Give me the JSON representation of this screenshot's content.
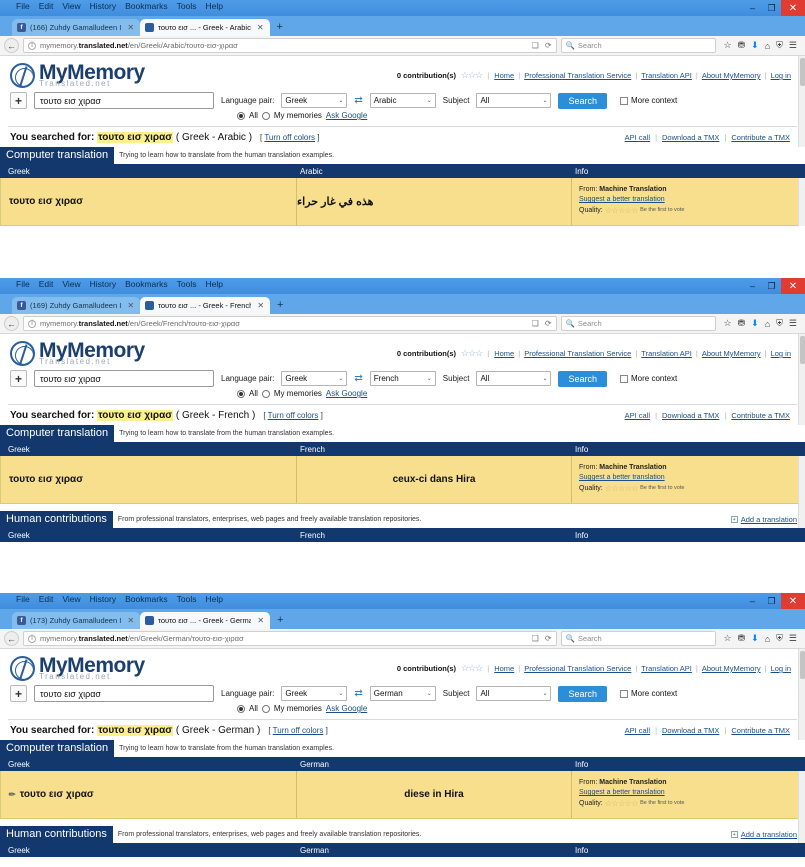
{
  "browser": {
    "menu_items": [
      "File",
      "Edit",
      "View",
      "History",
      "Bookmarks",
      "Tools",
      "Help"
    ],
    "window_controls": {
      "minimize": "–",
      "restore": "❐",
      "close": "✕"
    },
    "new_tab_label": "+",
    "tab_close_label": "✕",
    "nav": {
      "back_label": "←",
      "reader_label": "❑",
      "reload_label": "⟳",
      "search_placeholder": "Search",
      "search_icon": "🔍",
      "info_icon": "i"
    },
    "toolbar_icons": [
      "☆",
      "⛃",
      "⬇",
      "⌂",
      "⛨",
      "☰"
    ]
  },
  "site": {
    "logo_main": "MyMemory",
    "logo_sub": "Translated.net",
    "contributions": "0 contribution(s)",
    "contribution_stars": "☆☆☆",
    "links": [
      "Home",
      "Professional Translation Service",
      "Translation API",
      "About MyMemory",
      "Log in"
    ],
    "separator": "|"
  },
  "search_form": {
    "add_button": "+",
    "query": "τουτο εισ χιρασ",
    "language_pair_label": "Language pair:",
    "subject_label": "Subject",
    "subject_value": "All",
    "swap_icon": "⇄",
    "search_button": "Search",
    "more_context_label": "More context",
    "radio_all": "All",
    "radio_my_memories": "My memories",
    "ask_google": "Ask Google",
    "caret": "⌄"
  },
  "results_common": {
    "searched_prefix": "You searched for:",
    "turn_off_colors": "Turn off colors",
    "turn_off_open": "[",
    "turn_off_close": "]",
    "tmx_links": [
      "API call",
      "Download a TMX",
      "Contribute a TMX"
    ],
    "computer_translation_title": "Computer translation",
    "computer_translation_sub": "Trying to learn how to translate from the human translation examples.",
    "human_contributions_title": "Human contributions",
    "human_contributions_sub": "From professional translators, enterprises, web pages and freely available translation repositories.",
    "add_translation": "Add a translation",
    "col_info": "Info",
    "from_label": "From:",
    "from_value": "Machine Translation",
    "suggest_better": "Suggest a better translation",
    "quality_label": "Quality:",
    "quality_stars": "☆☆☆☆☆",
    "be_first_to_vote": "Be the first to vote",
    "source_text": "τουτο εισ χιρασ",
    "source_lang": "Greek"
  },
  "windows": [
    {
      "tab_fb": "(166) Zuhdy Gamalludeen I",
      "tab_page": "τουτο εισ ... - Greek - Arabic",
      "url_host_pre": "mymemory.",
      "url_host_bold": "translated.net",
      "url_path": "/en/Greek/Arabic/τουτο-εισ-χιρασ",
      "lang_from": "Greek",
      "lang_to": "Arabic",
      "pair_label": "( Greek - Arabic )",
      "translation": "هذه في غار حراء",
      "rtl": true,
      "has_human_section": false,
      "has_pencil": false
    },
    {
      "tab_fb": "(169) Zuhdy Gamalludeen I",
      "tab_page": "τουτο εισ ... - Greek - French",
      "url_host_pre": "mymemory.",
      "url_host_bold": "translated.net",
      "url_path": "/en/Greek/French/τουτο-εισ-χιρασ",
      "lang_from": "Greek",
      "lang_to": "French",
      "pair_label": "( Greek - French )",
      "translation": "ceux-ci dans Hira",
      "rtl": false,
      "has_human_section": true,
      "has_pencil": false
    },
    {
      "tab_fb": "(173) Zuhdy Gamalludeen I",
      "tab_page": "τουτο εισ ... - Greek - German",
      "url_host_pre": "mymemory.",
      "url_host_bold": "translated.net",
      "url_path": "/en/Greek/German/τουτο-εισ-χιρασ",
      "lang_from": "Greek",
      "lang_to": "German",
      "pair_label": "( Greek - German )",
      "translation": "diese in Hira",
      "rtl": false,
      "has_human_section": true,
      "has_pencil": true
    }
  ],
  "colors": {
    "band_blue": "#12386e",
    "result_yellow": "#f7df8e",
    "highlight_yellow": "#fbf08d",
    "link_blue": "#1a4f8a",
    "button_blue": "#2a8fd8",
    "titlebar_blue": "#4f9de8",
    "close_red": "#e03c31"
  }
}
